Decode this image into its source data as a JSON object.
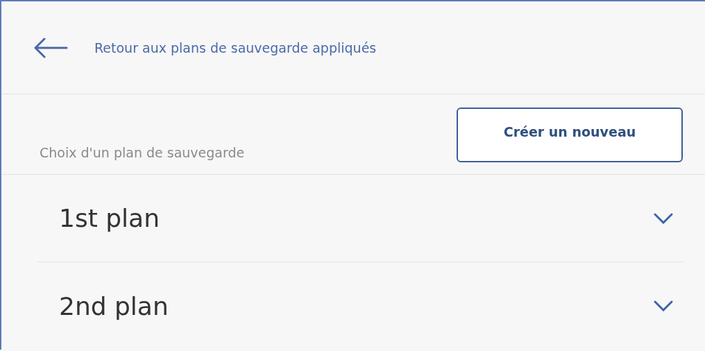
{
  "header": {
    "back_link": "Retour aux plans de sauvegarde appliqués"
  },
  "section": {
    "label": "Choix d'un plan de sauvegarde",
    "create_button": "Créer un nouveau"
  },
  "plans": [
    {
      "name": "1st plan",
      "expanded": false
    },
    {
      "name": "2nd plan",
      "expanded": false
    }
  ]
}
